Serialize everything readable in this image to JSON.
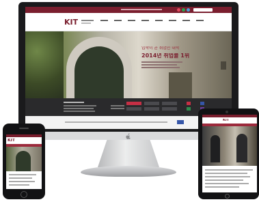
{
  "brand": {
    "logo": "KIT",
    "primary_color": "#7a1e2e",
    "accent_colors": [
      "#c62f45",
      "#2f8b4d",
      "#3656a8",
      "#6b3e98"
    ]
  },
  "hero": {
    "line1": "입학이 곧 취업인 대학",
    "line2": "2014년 취업률 1위"
  },
  "devices": {
    "monitor_logo_icon": "apple-logo-icon",
    "phone_logo": "KIT",
    "tablet_logo": "KIT"
  }
}
